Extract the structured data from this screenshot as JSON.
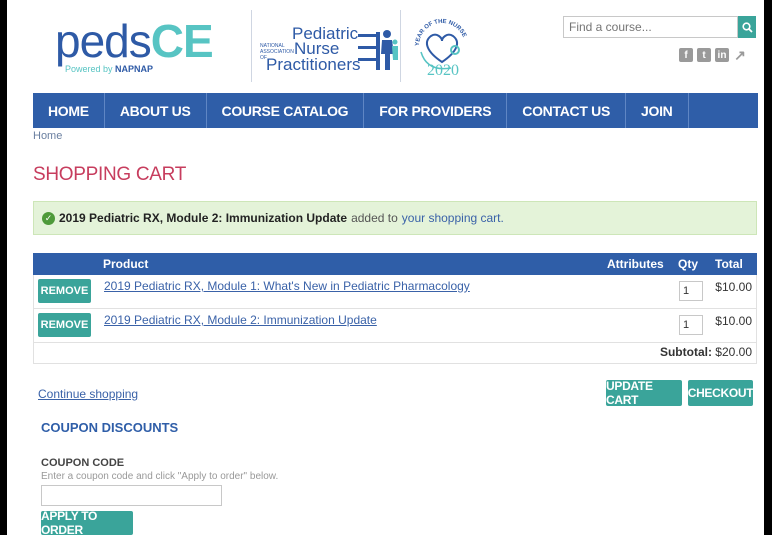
{
  "header": {
    "logo_peds": "peds",
    "logo_ce": "CE",
    "logo_sub_prefix": "Powered by",
    "logo_sub_brand": "NAPNAP",
    "pnp_line1": "Pediatric",
    "pnp_line2": "Nurse",
    "pnp_line3": "Practitioners",
    "pnp_assoc": "NATIONAL ASSOCIATION OF",
    "yon_text": "YEAR OF THE NURSE",
    "yon_year": "2020",
    "search_placeholder": "Find a course...",
    "social": [
      "f",
      "t",
      "in",
      "↗"
    ]
  },
  "nav": [
    "HOME",
    "ABOUT US",
    "COURSE CATALOG",
    "FOR PROVIDERS",
    "CONTACT US",
    "JOIN"
  ],
  "breadcrumb": "Home",
  "page_title": "SHOPPING CART",
  "message": {
    "item": "2019 Pediatric RX, Module 2: Immunization Update",
    "text": "added to",
    "link": "your shopping cart."
  },
  "table": {
    "headers": {
      "product": "Product",
      "attributes": "Attributes",
      "qty": "Qty",
      "total": "Total"
    },
    "remove_label": "REMOVE",
    "rows": [
      {
        "product": "2019 Pediatric RX, Module 1: What's New in Pediatric Pharmacology",
        "qty": "1",
        "total": "$10.00"
      },
      {
        "product": "2019 Pediatric RX, Module 2: Immunization Update",
        "qty": "1",
        "total": "$10.00"
      }
    ],
    "subtotal_label": "Subtotal:",
    "subtotal_value": "$20.00"
  },
  "actions": {
    "continue": "Continue shopping",
    "update": "UPDATE CART",
    "checkout": "CHECKOUT"
  },
  "coupon": {
    "heading": "COUPON DISCOUNTS",
    "label": "COUPON CODE",
    "hint": "Enter a coupon code and click \"Apply to order\" below.",
    "apply": "APPLY TO ORDER"
  },
  "colors": {
    "brand_blue": "#2f5ea8",
    "teal": "#3aa49a",
    "title_red": "#c73d5e",
    "success_bg": "#e4f3d9"
  }
}
